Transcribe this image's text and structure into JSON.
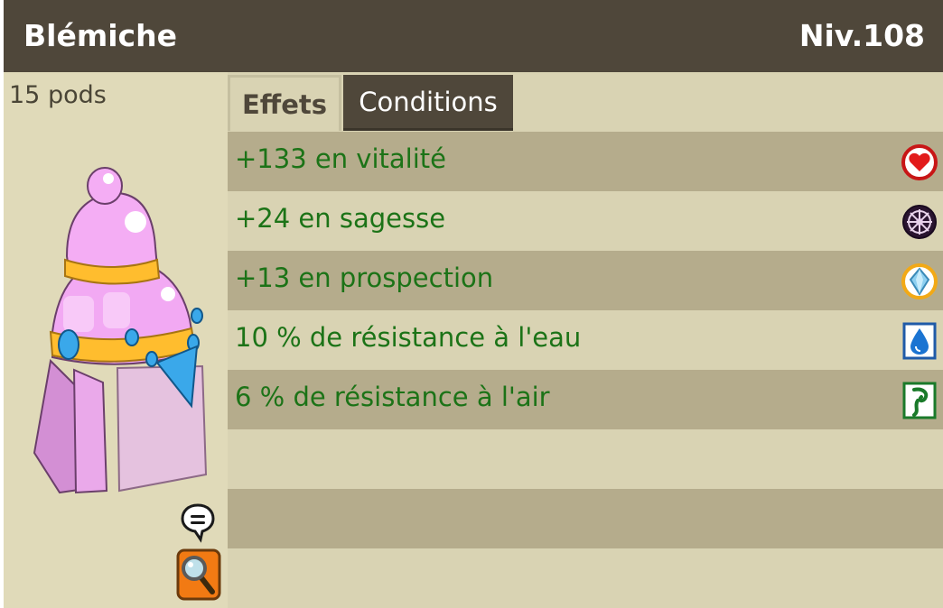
{
  "item": {
    "name": "Blémiche",
    "level": "Niv.108",
    "weight": "15 pods"
  },
  "tabs": [
    {
      "label": "Effets",
      "active": true
    },
    {
      "label": "Conditions",
      "active": false
    }
  ],
  "effects": [
    {
      "text": "+133 en vitalité",
      "icon": "vitality-heart-icon"
    },
    {
      "text": "+24 en sagesse",
      "icon": "wisdom-icon"
    },
    {
      "text": "+13 en prospection",
      "icon": "prospecting-icon"
    },
    {
      "text": "10 % de résistance à l'eau",
      "icon": "water-resistance-icon"
    },
    {
      "text": "6 % de résistance à l'air",
      "icon": "air-resistance-icon"
    }
  ],
  "colors": {
    "header_bg": "#4f473a",
    "panel_bg": "#e0dab9",
    "row_dark": "#b5ac8c",
    "row_light": "#d9d3b3",
    "effect_text": "#1c7317"
  }
}
